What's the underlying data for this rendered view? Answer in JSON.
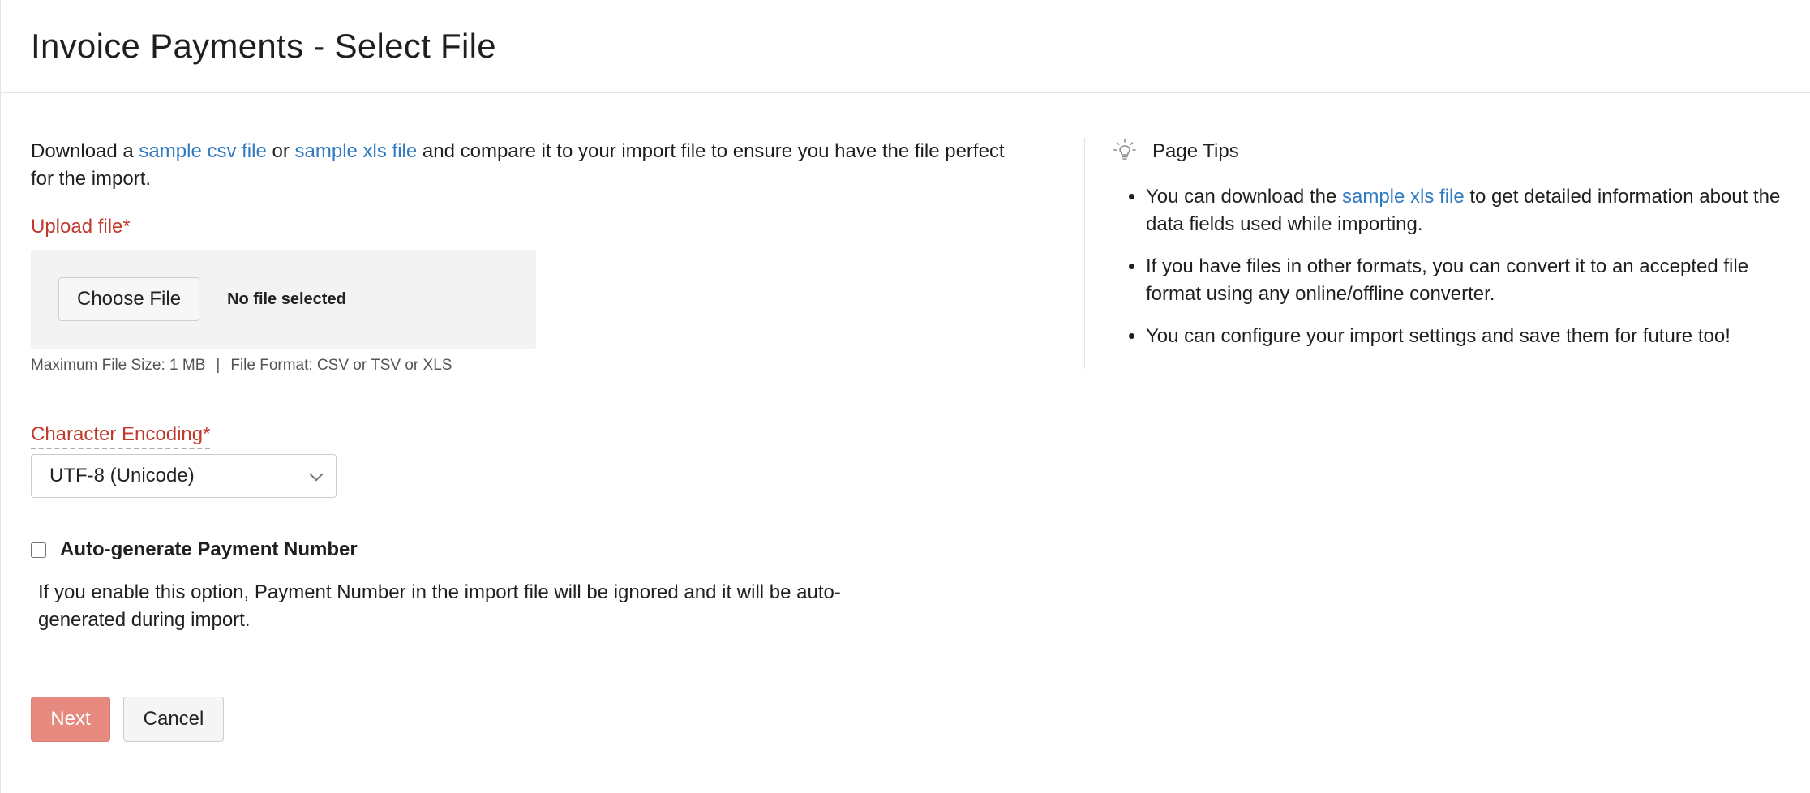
{
  "header": {
    "title": "Invoice Payments - Select File"
  },
  "intro": {
    "prefix": "Download a ",
    "csv_link": "sample csv file",
    "middle": " or ",
    "xls_link": "sample xls file",
    "suffix": " and compare it to your import file to ensure you have the file perfect for the import."
  },
  "upload": {
    "label": "Upload file",
    "required_mark": "*",
    "choose_button": "Choose File",
    "status": "No file selected",
    "max_size": "Maximum File Size: 1 MB",
    "separator": "|",
    "formats": "File Format: CSV or TSV or XLS"
  },
  "encoding": {
    "label": "Character Encoding",
    "required_mark": "*",
    "selected": "UTF-8 (Unicode)"
  },
  "auto_generate": {
    "label": "Auto-generate Payment Number",
    "checked": false,
    "help": "If you enable this option, Payment Number in the import file will be ignored and it will be auto-generated during import."
  },
  "actions": {
    "next": "Next",
    "cancel": "Cancel"
  },
  "tips": {
    "title": "Page Tips",
    "icon": "lightbulb-icon",
    "items": [
      {
        "prefix": "You can download the ",
        "link": "sample xls file",
        "suffix": " to get detailed information about the data fields used while importing."
      },
      {
        "text": "If you have files in other formats, you can convert it to an accepted file format using any online/offline converter."
      },
      {
        "text": "You can configure your import settings and save them for future too!"
      }
    ]
  },
  "colors": {
    "link": "#2f7ac2",
    "required_label": "#c0392b",
    "primary_button": "#e68a80"
  }
}
